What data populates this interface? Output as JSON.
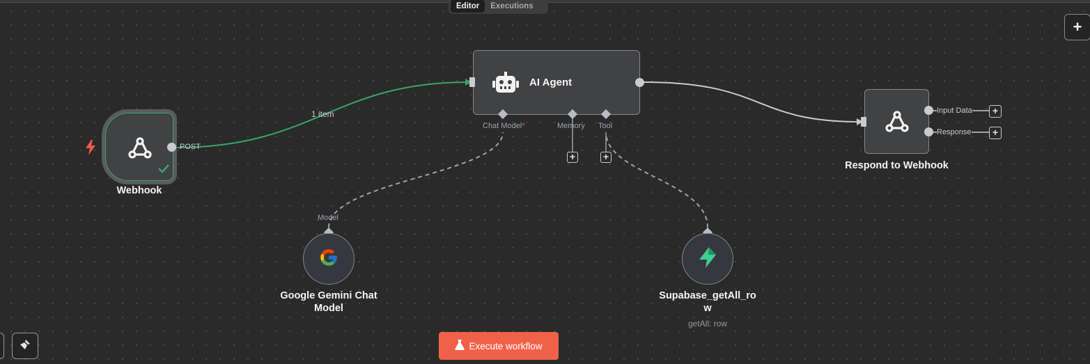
{
  "tabs": [
    {
      "label": "Editor",
      "active": true
    },
    {
      "label": "Executions",
      "active": false
    }
  ],
  "nodes": {
    "webhook": {
      "title": "Webhook",
      "output_label": "POST",
      "status": "success"
    },
    "ai_agent": {
      "title": "AI Agent",
      "ports": {
        "chat_model": "Chat Model",
        "required_marker": "*",
        "memory": "Memory",
        "tool": "Tool"
      }
    },
    "respond": {
      "title": "Respond to Webhook",
      "outputs": [
        "Input Data",
        "Response"
      ]
    },
    "gemini": {
      "title_line1": "Google Gemini Chat",
      "title_line2": "Model",
      "port_label": "Model"
    },
    "supabase": {
      "title_line1": "Supabase_getAll_ro",
      "title_line2": "w",
      "subtitle": "getAll: row"
    }
  },
  "edges": {
    "webhook_to_agent_label": "1 item"
  },
  "actions": {
    "execute_label": "Execute workflow",
    "add_node_label": "+"
  },
  "colors": {
    "canvas": "#2a2a2a",
    "success_edge": "#3aa46a",
    "execute_button": "#f0614a",
    "trigger_bolt": "#ee5a4a"
  },
  "icons": {
    "webhook": "webhook-icon",
    "agent": "robot-icon",
    "gemini": "google-g-icon",
    "supabase": "supabase-bolt-icon",
    "execute": "flask-icon",
    "trigger": "lightning-icon",
    "success": "checkmark-icon"
  }
}
